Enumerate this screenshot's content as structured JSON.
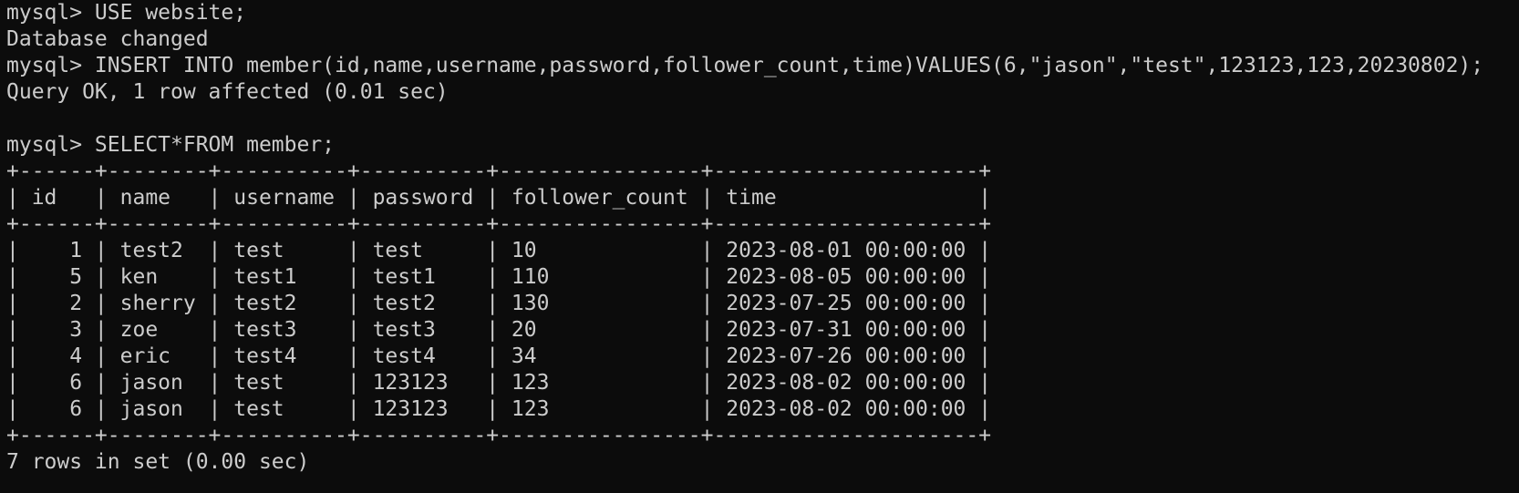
{
  "terminal": {
    "lines": [
      "mysql> USE website;",
      "Database changed",
      "mysql> INSERT INTO member(id,name,username,password,follower_count,time)VALUES(6,\"jason\",\"test\",123123,123,20230802);",
      "Query OK, 1 row affected (0.01 sec)",
      "",
      "mysql> SELECT*FROM member;",
      "+------+--------+----------+----------+----------------+---------------------+",
      "| id   | name   | username | password | follower_count | time                |",
      "+------+--------+----------+----------+----------------+---------------------+",
      "|    1 | test2  | test     | test     | 10             | 2023-08-01 00:00:00 |",
      "|    5 | ken    | test1    | test1    | 110            | 2023-08-05 00:00:00 |",
      "|    2 | sherry | test2    | test2    | 130            | 2023-07-25 00:00:00 |",
      "|    3 | zoe    | test3    | test3    | 20             | 2023-07-31 00:00:00 |",
      "|    4 | eric   | test4    | test4    | 34             | 2023-07-26 00:00:00 |",
      "|    6 | jason  | test     | 123123   | 123            | 2023-08-02 00:00:00 |",
      "|    6 | jason  | test     | 123123   | 123            | 2023-08-02 00:00:00 |",
      "+------+--------+----------+----------+----------------+---------------------+",
      "7 rows in set (0.00 sec)"
    ]
  }
}
